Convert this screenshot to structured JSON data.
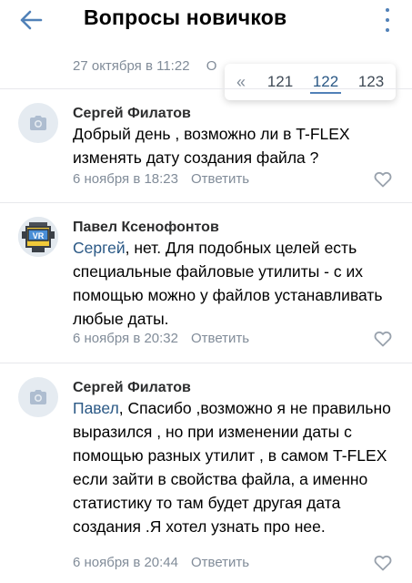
{
  "header": {
    "title": "Вопросы новичков"
  },
  "previous_comment": {
    "meta": "27 октября в 11:22",
    "reply_partial": "О"
  },
  "pager": {
    "prev_symbol": "«",
    "pages": [
      "121",
      "122",
      "123"
    ],
    "current": "122"
  },
  "comments": [
    {
      "author": "Сергей Филатов",
      "avatar": "camera-icon",
      "mention": "",
      "text": "Добрый день , возможно ли в T-FLEX изменять дату создания файла ?",
      "date": "6 ноября в 18:23",
      "reply_label": "Ответить"
    },
    {
      "author": "Павел Ксенофонтов",
      "avatar": "vr-robot-avatar",
      "avatar_label": "VR",
      "mention": "Сергей",
      "text": ", нет. Для подобных целей есть специальные файловые утилиты - с их помощью можно у файлов устанавливать любые даты.",
      "date": "6 ноября в 20:32",
      "reply_label": "Ответить"
    },
    {
      "author": "Сергей Филатов",
      "avatar": "camera-icon",
      "mention": "Павел",
      "text": ", Спасибо ,возможно я не правильно выразился , но при изменении даты с помощью разных утилит , в самом T-FLEX если зайти в свойства файла, а именно статистику то там будет другая дата создания .Я хотел узнать про нее.",
      "date": "6 ноября в 20:44",
      "reply_label": "Ответить"
    }
  ],
  "colors": {
    "accent": "#5181b8",
    "link": "#2a5885",
    "secondary_text": "#818c99",
    "divider": "#e7e8ec"
  }
}
